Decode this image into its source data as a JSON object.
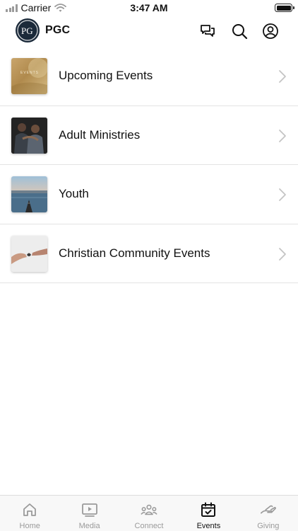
{
  "status_bar": {
    "carrier": "Carrier",
    "time": "3:47 AM"
  },
  "header": {
    "logo_letters": "PG",
    "brand": "PGC"
  },
  "list": [
    {
      "label": "Upcoming Events",
      "thumb_text": "EVENTS"
    },
    {
      "label": "Adult Ministries"
    },
    {
      "label": "Youth"
    },
    {
      "label": "Christian Community Events"
    }
  ],
  "tabs": [
    {
      "label": "Home",
      "icon": "home-icon"
    },
    {
      "label": "Media",
      "icon": "media-icon"
    },
    {
      "label": "Connect",
      "icon": "connect-icon"
    },
    {
      "label": "Events",
      "icon": "events-icon",
      "active": true
    },
    {
      "label": "Giving",
      "icon": "giving-icon"
    }
  ],
  "colors": {
    "active_tab": "#111111",
    "inactive_tab": "#9a9a9a",
    "logo_bg": "#1b2a3a"
  }
}
